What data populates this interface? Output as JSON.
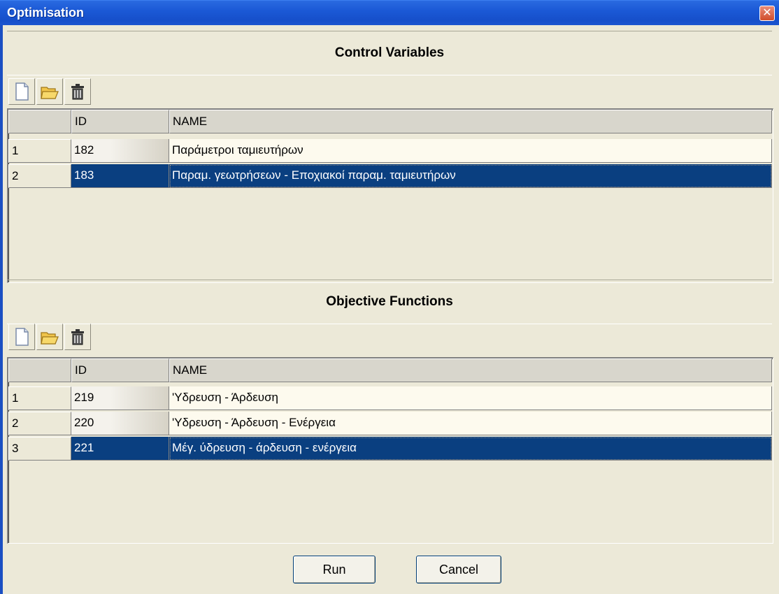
{
  "window": {
    "title": "Optimisation",
    "close_glyph": "✕"
  },
  "control_variables": {
    "heading": "Control Variables",
    "toolbar": {
      "new_icon": "new-document-icon",
      "open_icon": "open-folder-icon",
      "delete_icon": "trash-icon"
    },
    "columns": [
      "",
      "ID",
      "NAME"
    ],
    "rows": [
      {
        "num": "1",
        "id": "182",
        "name": "Παράμετροι ταμιευτήρων",
        "selected": false
      },
      {
        "num": "2",
        "id": "183",
        "name": "Παραμ. γεωτρήσεων - Εποχιακοί παραμ. ταμιευτήρων",
        "selected": true
      }
    ]
  },
  "objective_functions": {
    "heading": "Objective Functions",
    "toolbar": {
      "new_icon": "new-document-icon",
      "open_icon": "open-folder-icon",
      "delete_icon": "trash-icon"
    },
    "columns": [
      "",
      "ID",
      "NAME"
    ],
    "rows": [
      {
        "num": "1",
        "id": "219",
        "name": "'Υδρευση - Άρδευση",
        "selected": false
      },
      {
        "num": "2",
        "id": "220",
        "name": "'Υδρευση - Άρδευση - Ενέργεια",
        "selected": false
      },
      {
        "num": "3",
        "id": "221",
        "name": "Μέγ. ύδρευση - άρδευση - ενέργεια",
        "selected": true
      }
    ]
  },
  "buttons": {
    "run": "Run",
    "cancel": "Cancel"
  },
  "colors": {
    "selection": "#0a3f80",
    "titlebar": "#1b59d6",
    "face": "#ece9d8"
  }
}
